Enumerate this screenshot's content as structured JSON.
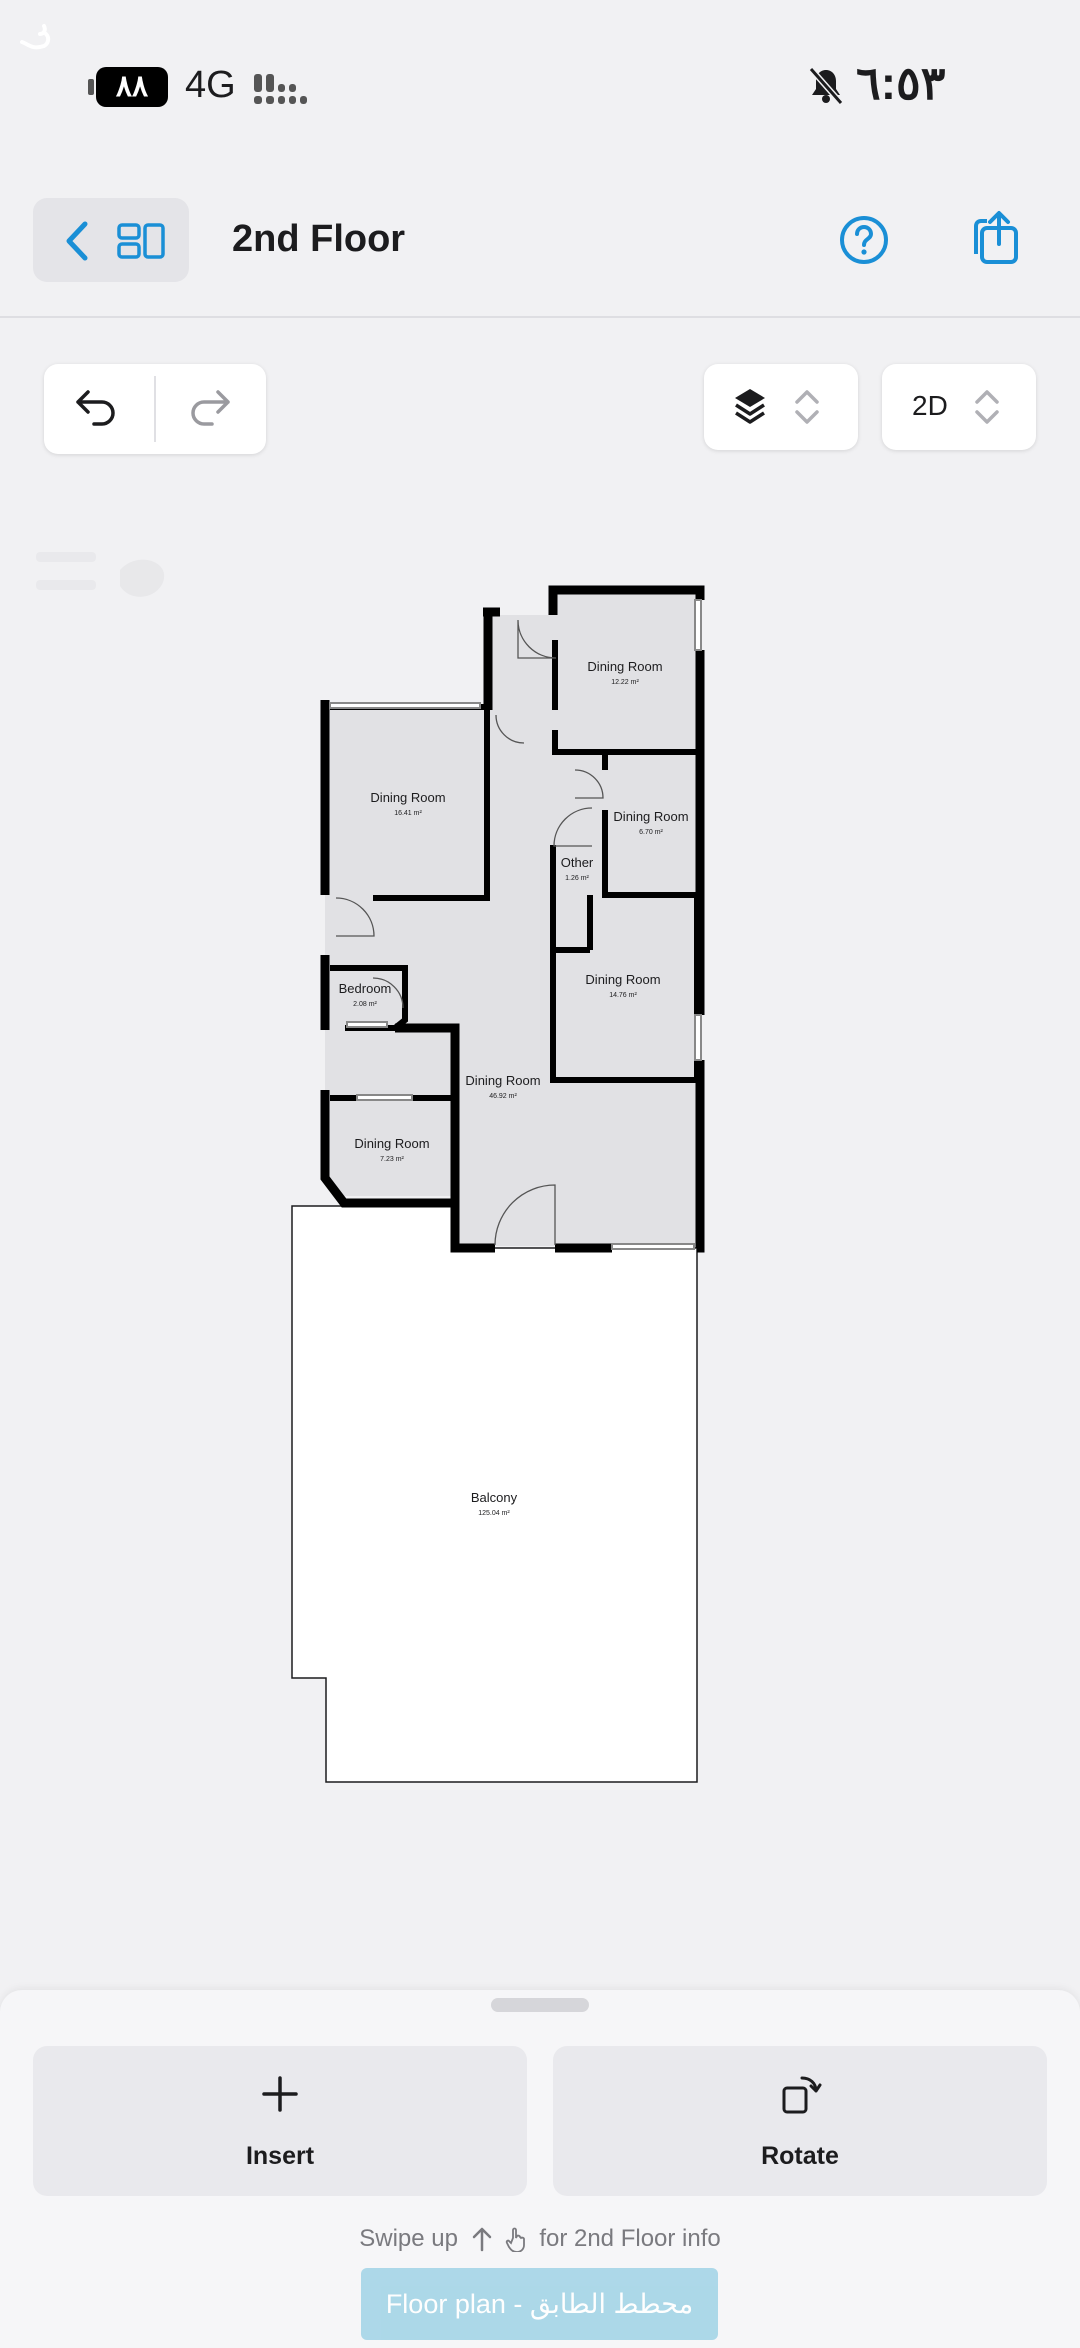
{
  "status_bar": {
    "battery": "٨٨",
    "network": "4G",
    "time": "٦:٥٣"
  },
  "header": {
    "title": "2nd Floor",
    "icons": [
      "back-chevron-icon",
      "floor-plans-icon",
      "help-icon",
      "share-icon"
    ]
  },
  "toolbar": {
    "view_mode": "2D",
    "icons": [
      "undo-icon",
      "redo-icon",
      "layers-icon",
      "selector-chevrons-icon"
    ]
  },
  "floor_plan": {
    "rooms": [
      {
        "name": "Dining Room",
        "area": "12.22 m²"
      },
      {
        "name": "Dining Room",
        "area": "16.41 m²"
      },
      {
        "name": "Dining Room",
        "area": "6.70 m²"
      },
      {
        "name": "Other",
        "area": "1.26 m²"
      },
      {
        "name": "Bedroom",
        "area": "2.08 m²"
      },
      {
        "name": "Dining Room",
        "area": "14.76 m²"
      },
      {
        "name": "Dining Room",
        "area": "46.92 m²"
      },
      {
        "name": "Dining Room",
        "area": "7.23 m²"
      },
      {
        "name": "Balcony",
        "area": "125.04 m²"
      }
    ]
  },
  "bottom_sheet": {
    "insert_label": "Insert",
    "rotate_label": "Rotate",
    "hint_pre": "Swipe up",
    "hint_post": "for 2nd Floor info",
    "banner": "Floor plan - محطط الطابق"
  },
  "colors": {
    "accent": "#1a8fd6",
    "room_fill": "#e1e1e4",
    "wall": "#000000",
    "banner": "#a5d5e7"
  }
}
